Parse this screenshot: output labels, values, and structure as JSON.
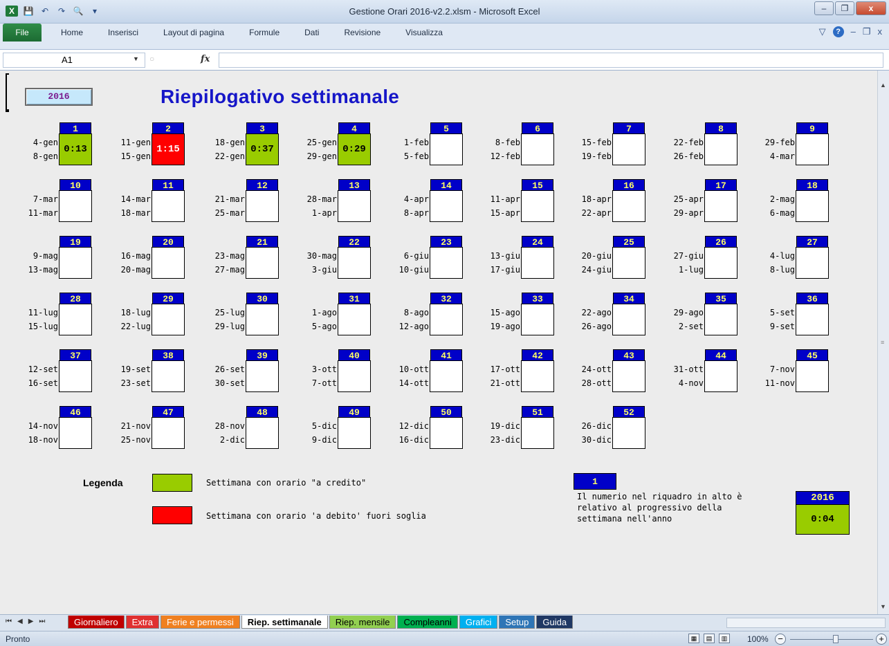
{
  "window": {
    "title": "Gestione Orari 2016-v2.2.xlsm - Microsoft Excel"
  },
  "ribbon": {
    "file_label": "File",
    "tabs": [
      "Home",
      "Inserisci",
      "Layout di pagina",
      "Formule",
      "Dati",
      "Revisione",
      "Visualizza"
    ]
  },
  "formula_bar": {
    "name_box": "A1",
    "fx": "fx",
    "value": ""
  },
  "sheet": {
    "year_button": "2016",
    "title": "Riepilogativo settimanale",
    "weeks": [
      {
        "num": "1",
        "start": "4-gen",
        "end": "8-gen",
        "value": "0:13",
        "status": "credit"
      },
      {
        "num": "2",
        "start": "11-gen",
        "end": "15-gen",
        "value": "1:15",
        "status": "debit"
      },
      {
        "num": "3",
        "start": "18-gen",
        "end": "22-gen",
        "value": "0:37",
        "status": "credit"
      },
      {
        "num": "4",
        "start": "25-gen",
        "end": "29-gen",
        "value": "0:29",
        "status": "credit"
      },
      {
        "num": "5",
        "start": "1-feb",
        "end": "5-feb",
        "value": "",
        "status": "none"
      },
      {
        "num": "6",
        "start": "8-feb",
        "end": "12-feb",
        "value": "",
        "status": "none"
      },
      {
        "num": "7",
        "start": "15-feb",
        "end": "19-feb",
        "value": "",
        "status": "none"
      },
      {
        "num": "8",
        "start": "22-feb",
        "end": "26-feb",
        "value": "",
        "status": "none"
      },
      {
        "num": "9",
        "start": "29-feb",
        "end": "4-mar",
        "value": "",
        "status": "none"
      },
      {
        "num": "10",
        "start": "7-mar",
        "end": "11-mar",
        "value": "",
        "status": "none"
      },
      {
        "num": "11",
        "start": "14-mar",
        "end": "18-mar",
        "value": "",
        "status": "none"
      },
      {
        "num": "12",
        "start": "21-mar",
        "end": "25-mar",
        "value": "",
        "status": "none"
      },
      {
        "num": "13",
        "start": "28-mar",
        "end": "1-apr",
        "value": "",
        "status": "none"
      },
      {
        "num": "14",
        "start": "4-apr",
        "end": "8-apr",
        "value": "",
        "status": "none"
      },
      {
        "num": "15",
        "start": "11-apr",
        "end": "15-apr",
        "value": "",
        "status": "none"
      },
      {
        "num": "16",
        "start": "18-apr",
        "end": "22-apr",
        "value": "",
        "status": "none"
      },
      {
        "num": "17",
        "start": "25-apr",
        "end": "29-apr",
        "value": "",
        "status": "none"
      },
      {
        "num": "18",
        "start": "2-mag",
        "end": "6-mag",
        "value": "",
        "status": "none"
      },
      {
        "num": "19",
        "start": "9-mag",
        "end": "13-mag",
        "value": "",
        "status": "none"
      },
      {
        "num": "20",
        "start": "16-mag",
        "end": "20-mag",
        "value": "",
        "status": "none"
      },
      {
        "num": "21",
        "start": "23-mag",
        "end": "27-mag",
        "value": "",
        "status": "none"
      },
      {
        "num": "22",
        "start": "30-mag",
        "end": "3-giu",
        "value": "",
        "status": "none"
      },
      {
        "num": "23",
        "start": "6-giu",
        "end": "10-giu",
        "value": "",
        "status": "none"
      },
      {
        "num": "24",
        "start": "13-giu",
        "end": "17-giu",
        "value": "",
        "status": "none"
      },
      {
        "num": "25",
        "start": "20-giu",
        "end": "24-giu",
        "value": "",
        "status": "none"
      },
      {
        "num": "26",
        "start": "27-giu",
        "end": "1-lug",
        "value": "",
        "status": "none"
      },
      {
        "num": "27",
        "start": "4-lug",
        "end": "8-lug",
        "value": "",
        "status": "none"
      },
      {
        "num": "28",
        "start": "11-lug",
        "end": "15-lug",
        "value": "",
        "status": "none"
      },
      {
        "num": "29",
        "start": "18-lug",
        "end": "22-lug",
        "value": "",
        "status": "none"
      },
      {
        "num": "30",
        "start": "25-lug",
        "end": "29-lug",
        "value": "",
        "status": "none"
      },
      {
        "num": "31",
        "start": "1-ago",
        "end": "5-ago",
        "value": "",
        "status": "none"
      },
      {
        "num": "32",
        "start": "8-ago",
        "end": "12-ago",
        "value": "",
        "status": "none"
      },
      {
        "num": "33",
        "start": "15-ago",
        "end": "19-ago",
        "value": "",
        "status": "none"
      },
      {
        "num": "34",
        "start": "22-ago",
        "end": "26-ago",
        "value": "",
        "status": "none"
      },
      {
        "num": "35",
        "start": "29-ago",
        "end": "2-set",
        "value": "",
        "status": "none"
      },
      {
        "num": "36",
        "start": "5-set",
        "end": "9-set",
        "value": "",
        "status": "none"
      },
      {
        "num": "37",
        "start": "12-set",
        "end": "16-set",
        "value": "",
        "status": "none"
      },
      {
        "num": "38",
        "start": "19-set",
        "end": "23-set",
        "value": "",
        "status": "none"
      },
      {
        "num": "39",
        "start": "26-set",
        "end": "30-set",
        "value": "",
        "status": "none"
      },
      {
        "num": "40",
        "start": "3-ott",
        "end": "7-ott",
        "value": "",
        "status": "none"
      },
      {
        "num": "41",
        "start": "10-ott",
        "end": "14-ott",
        "value": "",
        "status": "none"
      },
      {
        "num": "42",
        "start": "17-ott",
        "end": "21-ott",
        "value": "",
        "status": "none"
      },
      {
        "num": "43",
        "start": "24-ott",
        "end": "28-ott",
        "value": "",
        "status": "none"
      },
      {
        "num": "44",
        "start": "31-ott",
        "end": "4-nov",
        "value": "",
        "status": "none"
      },
      {
        "num": "45",
        "start": "7-nov",
        "end": "11-nov",
        "value": "",
        "status": "none"
      },
      {
        "num": "46",
        "start": "14-nov",
        "end": "18-nov",
        "value": "",
        "status": "none"
      },
      {
        "num": "47",
        "start": "21-nov",
        "end": "25-nov",
        "value": "",
        "status": "none"
      },
      {
        "num": "48",
        "start": "28-nov",
        "end": "2-dic",
        "value": "",
        "status": "none"
      },
      {
        "num": "49",
        "start": "5-dic",
        "end": "9-dic",
        "value": "",
        "status": "none"
      },
      {
        "num": "50",
        "start": "12-dic",
        "end": "16-dic",
        "value": "",
        "status": "none"
      },
      {
        "num": "51",
        "start": "19-dic",
        "end": "23-dic",
        "value": "",
        "status": "none"
      },
      {
        "num": "52",
        "start": "26-dic",
        "end": "30-dic",
        "value": "",
        "status": "none"
      }
    ],
    "legend": {
      "title": "Legenda",
      "credit_text": "Settimana con orario \"a credito\"",
      "debit_text": "Settimana con orario 'a debito' fuori soglia",
      "credit_color": "#99cc00",
      "debit_color": "#ff0000"
    },
    "info": {
      "sample_number": "1",
      "text": "Il numerio nel riquadro in alto è relativo al progressivo della settimana nell'anno"
    },
    "total": {
      "year": "2016",
      "value": "0:04"
    }
  },
  "sheet_tabs": [
    {
      "label": "Giornaliero",
      "bg": "#c00000",
      "fg": "#ffffff",
      "active": false
    },
    {
      "label": "Extra",
      "bg": "#e03030",
      "fg": "#ffffff",
      "active": false
    },
    {
      "label": "Ferie e permessi",
      "bg": "#f08020",
      "fg": "#ffffff",
      "active": false
    },
    {
      "label": "Riep. settimanale",
      "bg": "#ffffff",
      "fg": "#000000",
      "active": true
    },
    {
      "label": "Riep. mensile",
      "bg": "#92d050",
      "fg": "#000000",
      "active": false
    },
    {
      "label": "Compleanni",
      "bg": "#00b050",
      "fg": "#000000",
      "active": false
    },
    {
      "label": "Grafici",
      "bg": "#00b0f0",
      "fg": "#ffffff",
      "active": false
    },
    {
      "label": "Setup",
      "bg": "#2e75b6",
      "fg": "#ffffff",
      "active": false
    },
    {
      "label": "Guida",
      "bg": "#1f3864",
      "fg": "#ffffff",
      "active": false
    }
  ],
  "status": {
    "text": "Pronto",
    "zoom": "100%"
  }
}
